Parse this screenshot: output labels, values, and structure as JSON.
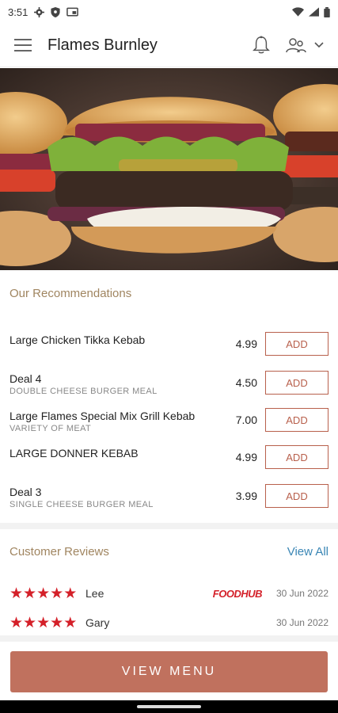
{
  "status_bar": {
    "time": "3:51",
    "icons": [
      "gear-icon",
      "shield-icon",
      "cast-icon",
      "wifi-icon",
      "signal-icon",
      "battery-icon"
    ]
  },
  "app_bar": {
    "title": "Flames Burnley",
    "icons": [
      "hamburger-menu-icon",
      "bell-icon",
      "person-icon",
      "chevron-down-icon"
    ]
  },
  "hero": {
    "image": "burger-photo"
  },
  "recommendations": {
    "title": "Our Recommendations",
    "items": [
      {
        "name": "Large Chicken Tikka Kebab",
        "subtitle": "",
        "price": "4.99",
        "button": "ADD"
      },
      {
        "name": "Deal 4",
        "subtitle": "DOUBLE CHEESE BURGER MEAL",
        "price": "4.50",
        "button": "ADD"
      },
      {
        "name": "Large Flames Special Mix Grill Kebab",
        "subtitle": "VARIETY OF MEAT",
        "price": "7.00",
        "button": "ADD"
      },
      {
        "name": "LARGE DONNER KEBAB",
        "subtitle": "",
        "price": "4.99",
        "button": "ADD"
      },
      {
        "name": "Deal 3",
        "subtitle": "SINGLE CHEESE BURGER MEAL",
        "price": "3.99",
        "button": "ADD"
      }
    ]
  },
  "reviews": {
    "title": "Customer Reviews",
    "view_all": "View All",
    "items": [
      {
        "rating": 5,
        "name": "Lee",
        "source": "FOODHUB",
        "date": "30 Jun 2022"
      },
      {
        "rating": 5,
        "name": "Gary",
        "source": "",
        "date": "30 Jun 2022"
      }
    ]
  },
  "view_menu_label": "VIEW MENU",
  "colors": {
    "accent": "#c0715e",
    "add_border": "#b8604c",
    "section_title": "#a08560",
    "link": "#3a86b5",
    "star": "#d42029"
  }
}
